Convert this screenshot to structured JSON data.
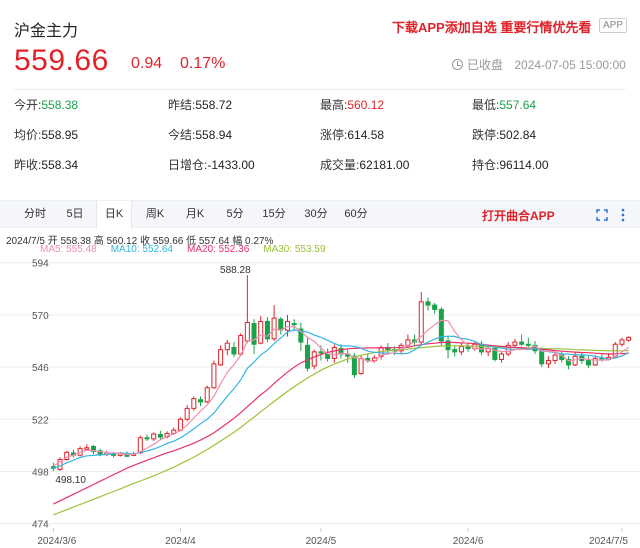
{
  "header": {
    "title": "沪金主力",
    "promo": "下载APP添加自选  重要行情优先看",
    "app_badge": "APP",
    "price": "559.66",
    "change": "0.94",
    "change_pct": "0.17%",
    "status": "已收盘",
    "datetime": "2024-07-05 15:00:00"
  },
  "stats": [
    {
      "label": "今开:",
      "value": "558.38",
      "color": "green"
    },
    {
      "label": "昨结:",
      "value": "558.72",
      "color": ""
    },
    {
      "label": "最高:",
      "value": "560.12",
      "color": "red"
    },
    {
      "label": "最低:",
      "value": "557.64",
      "color": "green"
    },
    {
      "label": "均价:",
      "value": "558.95",
      "color": ""
    },
    {
      "label": "今结:",
      "value": "558.94",
      "color": ""
    },
    {
      "label": "涨停:",
      "value": "614.58",
      "color": ""
    },
    {
      "label": "跌停:",
      "value": "502.84",
      "color": ""
    },
    {
      "label": "昨收:",
      "value": "558.34",
      "color": ""
    },
    {
      "label": "日增仓:",
      "value": "-1433.00",
      "color": ""
    },
    {
      "label": "成交量:",
      "value": "62181.00",
      "color": ""
    },
    {
      "label": "持仓:",
      "value": "96114.00",
      "color": ""
    }
  ],
  "tabs": [
    "分时",
    "5日",
    "日K",
    "周K",
    "月K",
    "5分",
    "15分",
    "30分",
    "60分"
  ],
  "active_tab": "日K",
  "open_app": "打开曲合APP",
  "ohlc_line": "2024/7/5  开 558.38  高 560.12  收 559.66  低 557.64  幅 0.27%",
  "ma_legend": [
    {
      "label": "MA5: 555.48",
      "color": "#f08fb0"
    },
    {
      "label": "MA10: 552.64",
      "color": "#33b5e5"
    },
    {
      "label": "MA20: 552.36",
      "color": "#e8336b"
    },
    {
      "label": "MA30: 553.59",
      "color": "#9bc23a"
    }
  ],
  "colors": {
    "up": "#e0232b",
    "down": "#1aa24a",
    "grid": "#eeeeee"
  },
  "chart_data": {
    "type": "candlestick",
    "y_ticks": [
      474,
      498,
      522,
      546,
      570,
      594
    ],
    "ylim": [
      472,
      598
    ],
    "x_labels": [
      "2024/3/6",
      "2024/4",
      "2024/5",
      "2024/6",
      "2024/7/5"
    ],
    "x_label_index": [
      0,
      19,
      40,
      62,
      85
    ],
    "max_label": "588.28",
    "min_label": "498.10",
    "max_index": 29,
    "min_index": 0,
    "candles": [
      [
        500.2,
        499.5,
        502,
        498.1
      ],
      [
        499,
        503.5,
        504.5,
        498.3
      ],
      [
        503.5,
        506.8,
        507.5,
        503
      ],
      [
        506.5,
        505.5,
        508,
        504.5
      ],
      [
        505.5,
        508.5,
        509.5,
        505
      ],
      [
        508.2,
        508.9,
        510.5,
        507.5
      ],
      [
        509.5,
        507.2,
        510.2,
        506
      ],
      [
        507.5,
        505.8,
        508.5,
        505
      ],
      [
        505.8,
        506.5,
        507.5,
        505
      ],
      [
        506,
        505.4,
        507,
        504.5
      ],
      [
        505.4,
        506.2,
        507,
        504.8
      ],
      [
        505.8,
        505,
        507.2,
        504.5
      ],
      [
        505.4,
        505.9,
        507,
        505
      ],
      [
        506.6,
        513.5,
        514.5,
        506
      ],
      [
        513.5,
        513,
        515,
        512
      ],
      [
        513,
        515.2,
        516,
        512
      ],
      [
        515,
        513.8,
        516.8,
        512.5
      ],
      [
        514,
        515.5,
        516.5,
        513.2
      ],
      [
        515.5,
        517,
        518.2,
        514.8
      ],
      [
        517,
        522,
        523,
        516.5
      ],
      [
        522,
        527,
        528.5,
        521
      ],
      [
        527,
        531.5,
        532.5,
        526
      ],
      [
        531,
        530,
        532.5,
        528
      ],
      [
        530,
        536.5,
        537.5,
        529.5
      ],
      [
        536.5,
        547.5,
        549,
        536
      ],
      [
        547,
        554,
        556,
        546.5
      ],
      [
        554,
        557,
        558.5,
        551.5
      ],
      [
        555,
        552,
        557.5,
        550.5
      ],
      [
        552,
        560.5,
        561.5,
        551
      ],
      [
        558,
        566.5,
        588.28,
        557
      ],
      [
        566,
        556.5,
        568,
        552
      ],
      [
        557,
        567,
        569.5,
        556.5
      ],
      [
        567,
        559,
        569,
        557.5
      ],
      [
        559,
        568.5,
        574.5,
        558
      ],
      [
        568,
        563,
        569,
        561
      ],
      [
        563,
        567,
        570,
        560
      ],
      [
        566,
        565.5,
        568,
        562.5
      ],
      [
        563.5,
        557.5,
        566.5,
        553.5
      ],
      [
        556,
        545.5,
        560,
        544
      ],
      [
        546.5,
        553,
        554,
        545
      ],
      [
        553,
        552.5,
        556,
        549
      ],
      [
        552,
        550,
        554.5,
        548.5
      ],
      [
        550,
        555,
        556.5,
        548
      ],
      [
        554.5,
        552,
        556.5,
        550
      ],
      [
        552,
        551,
        554,
        548
      ],
      [
        551,
        542.5,
        552.5,
        541
      ],
      [
        543,
        550,
        551.5,
        542.5
      ],
      [
        550,
        549,
        552,
        548
      ],
      [
        549,
        550.2,
        551.5,
        548
      ],
      [
        551,
        555,
        556,
        549.5
      ],
      [
        555,
        554,
        557,
        552.5
      ],
      [
        554,
        553.5,
        555.5,
        551.5
      ],
      [
        553.5,
        556,
        557,
        552
      ],
      [
        556,
        558.5,
        561,
        555
      ],
      [
        558.5,
        557.5,
        561,
        556
      ],
      [
        557.5,
        576,
        580.5,
        556.5
      ],
      [
        576,
        574.5,
        578,
        572
      ],
      [
        574.5,
        572.5,
        575.5,
        570.5
      ],
      [
        572.5,
        558,
        573.5,
        556
      ],
      [
        558,
        554,
        560,
        550
      ],
      [
        554,
        553,
        556,
        551
      ],
      [
        553,
        555.5,
        557,
        551.5
      ],
      [
        555.5,
        554.5,
        557,
        553
      ],
      [
        554.5,
        556.5,
        557.5,
        553.5
      ],
      [
        556.5,
        553,
        558,
        551.5
      ],
      [
        553,
        554.5,
        556,
        551
      ],
      [
        554.5,
        549.5,
        556,
        548.5
      ],
      [
        549.5,
        552,
        553.5,
        548
      ],
      [
        552,
        556,
        557.5,
        551
      ],
      [
        556,
        557.5,
        559,
        555
      ],
      [
        557.5,
        556.5,
        561,
        555.5
      ],
      [
        556.5,
        556,
        559.5,
        554.5
      ],
      [
        556,
        553.5,
        558,
        552
      ],
      [
        553.5,
        547.5,
        555,
        546
      ],
      [
        547.5,
        549,
        551,
        545.5
      ],
      [
        549,
        551.5,
        553,
        547.5
      ],
      [
        551.5,
        549.5,
        553,
        548
      ],
      [
        549.5,
        547,
        551,
        545
      ],
      [
        547,
        551,
        553,
        546.5
      ],
      [
        551,
        549,
        552.5,
        547.5
      ],
      [
        549,
        547,
        551,
        545.5
      ],
      [
        547,
        550,
        551.5,
        546.5
      ],
      [
        550,
        549.5,
        552,
        548.5
      ],
      [
        549.5,
        550.5,
        552.5,
        549
      ],
      [
        550.5,
        556.5,
        557.5,
        550
      ],
      [
        556.5,
        558.5,
        559.5,
        555.5
      ],
      [
        558.38,
        559.66,
        560.12,
        557.64
      ]
    ],
    "ma5": [
      500.5,
      502.5,
      504.5,
      505.5,
      506.8,
      507.8,
      507.6,
      507.2,
      506.6,
      506.6,
      506.2,
      505.8,
      505.8,
      507.2,
      508.8,
      510.5,
      512.5,
      514.2,
      515.3,
      516.7,
      519.3,
      522.6,
      525.7,
      528.6,
      532.5,
      538.3,
      543.6,
      547.2,
      551.4,
      557.7,
      558.5,
      560.6,
      560.2,
      563.5,
      563,
      564.6,
      564.6,
      562.5,
      559.6,
      557.8,
      554.8,
      552.1,
      551.6,
      552.3,
      552.1,
      550.2,
      549.9,
      548.9,
      548.6,
      551.6,
      552,
      552.6,
      554.3,
      556,
      557.6,
      560.1,
      563,
      565.5,
      567.5,
      567.3,
      562.4,
      558.6,
      556,
      554.5,
      554.3,
      554.8,
      553.7,
      553.1,
      553.3,
      554,
      554.1,
      554.4,
      555.9,
      553.2,
      553.3,
      553,
      551.3,
      548.9,
      549.3,
      550,
      549.5,
      549.2,
      549.3,
      549.2,
      551.1,
      553,
      555
    ],
    "ma10": [
      499.5,
      500.5,
      502,
      503.2,
      504.4,
      505.2,
      505.4,
      505.6,
      505.8,
      506.2,
      506.5,
      506.3,
      506,
      506.8,
      507.4,
      508.3,
      509.5,
      510.9,
      511.9,
      513.4,
      515.4,
      517.6,
      519.9,
      522.1,
      524.9,
      528.7,
      532.6,
      536,
      540.1,
      545.4,
      548.3,
      551.6,
      553.7,
      556.8,
      559.4,
      562.2,
      563.1,
      562.5,
      562.1,
      560.7,
      559.7,
      558.3,
      556.9,
      555.7,
      555.8,
      555.5,
      554.7,
      553.3,
      552.8,
      552.5,
      552.4,
      552.4,
      552.1,
      552.3,
      553.9,
      556.1,
      557.4,
      558.9,
      559.9,
      560.2,
      560.1,
      559.2,
      558.8,
      557.8,
      556.4,
      555.6,
      555.1,
      554.7,
      554.3,
      554.1,
      554.4,
      554.1,
      554.5,
      553.7,
      553.1,
      552.7,
      552.1,
      551.9,
      551.7,
      551.6,
      551.4,
      551,
      550.3,
      549.7,
      550.2,
      551.1,
      552.6
    ],
    "ma20": [
      483,
      484.5,
      486,
      487.5,
      489,
      490.5,
      492,
      493.5,
      495,
      496.5,
      498,
      499.5,
      500.8,
      502,
      503.2,
      504.3,
      505.5,
      506.6,
      507.5,
      508.6,
      509.8,
      511,
      512.4,
      514,
      515.8,
      518,
      520.2,
      522.5,
      525,
      527.8,
      530.5,
      533.2,
      535.6,
      538.5,
      541.1,
      543.7,
      546,
      547.9,
      549.3,
      550.7,
      551.8,
      552.8,
      553.4,
      554,
      554.4,
      554.6,
      554.7,
      554.8,
      554.8,
      554.8,
      554.8,
      554.9,
      555,
      555.1,
      555.8,
      556.3,
      556.7,
      557,
      557.3,
      557.4,
      557.3,
      557.1,
      557,
      556.8,
      556.4,
      556.1,
      555.8,
      555.5,
      555.2,
      555,
      554.9,
      554.6,
      554.5,
      554.2,
      553.9,
      553.6,
      553.3,
      553.1,
      552.9,
      552.7,
      552.6,
      552.4,
      552.2,
      552,
      552.1,
      552.2,
      552.4
    ],
    "ma30": [
      478,
      479.2,
      480.4,
      481.6,
      482.8,
      484,
      485.2,
      486.4,
      487.6,
      488.8,
      490,
      491.2,
      492.4,
      493.6,
      494.8,
      496,
      497.3,
      498.6,
      500,
      501.5,
      503,
      504.6,
      506.3,
      508.1,
      510,
      512,
      514,
      516,
      518.2,
      520.6,
      523,
      525.5,
      527.8,
      530.2,
      532.5,
      534.8,
      537,
      539,
      541,
      542.8,
      544.5,
      546,
      547.4,
      548.6,
      549.7,
      550.6,
      551.4,
      552.1,
      552.6,
      553.1,
      553.5,
      553.8,
      554.1,
      554.3,
      554.6,
      554.9,
      555.2,
      555.5,
      555.7,
      555.8,
      555.8,
      555.8,
      555.7,
      555.6,
      555.5,
      555.4,
      555.3,
      555.2,
      555.1,
      555,
      554.9,
      554.8,
      554.7,
      554.6,
      554.5,
      554.4,
      554.3,
      554.2,
      554,
      553.9,
      553.8,
      553.7,
      553.6,
      553.5,
      553.5,
      553.5,
      553.59
    ]
  }
}
